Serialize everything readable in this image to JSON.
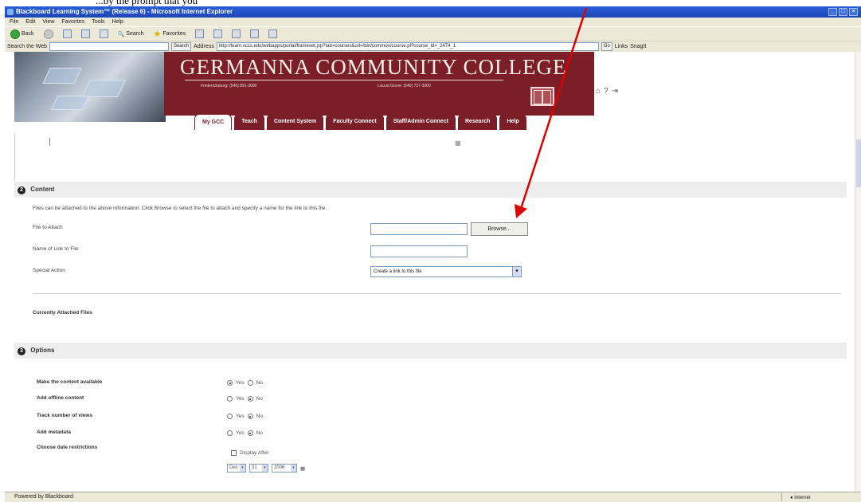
{
  "instruction": "...by the prompt that you",
  "window": {
    "title": "Blackboard Learning System™ (Release 6) - Microsoft Internet Explorer",
    "controls": [
      "_",
      "□",
      "×"
    ]
  },
  "menu": [
    "File",
    "Edit",
    "View",
    "Favorites",
    "Tools",
    "Help"
  ],
  "toolbar": {
    "back": "Back",
    "search": "Search",
    "favorites": "Favorites"
  },
  "addressbar": {
    "search_web_label": "Search the Web",
    "search_btn": "Search",
    "address_label": "Address",
    "url": "http://learn.vccs.edu/webapps/portal/frameset.jsp?tab=courses&url=/bin/common/course.pl?course_id=_2474_1",
    "go": "Go",
    "links": "Links",
    "snagit": "SnagIt"
  },
  "header": {
    "college_name": "GERMANNA COMMUNITY COLLEGE",
    "sub_left": "Fredericksburg: (540) 891-3000",
    "sub_right": "Locust Grove: (540) 727-3000",
    "tabs": [
      "My GCC",
      "Teach",
      "Content System",
      "Faculty Connect",
      "Staff/Admin Connect",
      "Research",
      "Help"
    ],
    "active_tab": "My GCC"
  },
  "section_content": {
    "number": "2",
    "title": "Content",
    "note": "Files can be attached to the above information. Click Browse to select the file to attach and specify a name for the link to this file.",
    "file_label": "File to Attach",
    "browse": "Browse...",
    "link_name_label": "Name of Link to File",
    "special_action_label": "Special Action",
    "special_action_value": "Create a link to this file",
    "attached_files_label": "Currently Attached Files"
  },
  "section_options": {
    "number": "3",
    "title": "Options",
    "rows": [
      {
        "label": "Make the content available",
        "yes": "Yes",
        "no": "No",
        "selected": "yes"
      },
      {
        "label": "Add offline content",
        "yes": "Yes",
        "no": "No",
        "selected": "no"
      },
      {
        "label": "Track number of views",
        "yes": "Yes",
        "no": "No",
        "selected": "no"
      },
      {
        "label": "Add metadata",
        "yes": "Yes",
        "no": "No",
        "selected": "no"
      }
    ],
    "date_label": "Choose date restrictions",
    "display_after": "Display After",
    "date_month": "Dec",
    "date_day": "31",
    "date_year": "2006"
  },
  "status": {
    "left": "Powered by Blackboard",
    "zone": "Internet"
  },
  "annotation_color": "#e00000"
}
